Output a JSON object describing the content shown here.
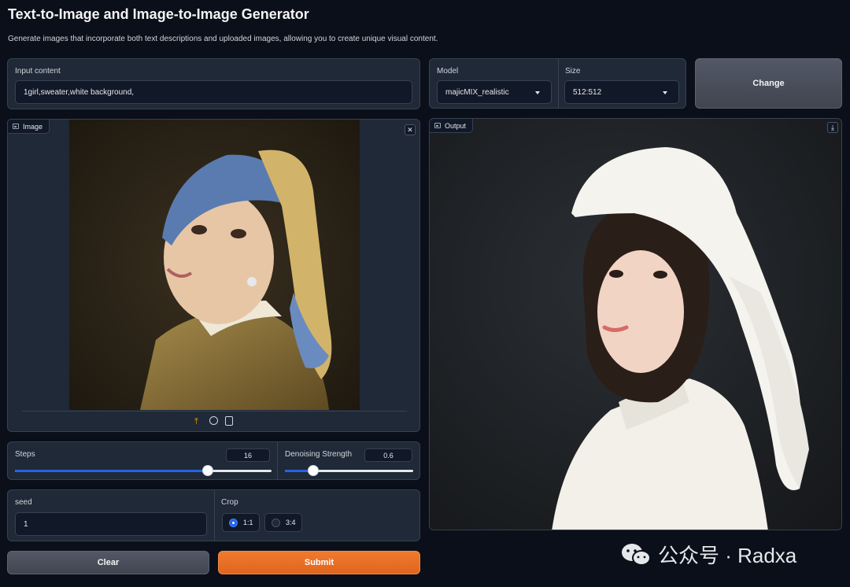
{
  "header": {
    "title": "Text-to-Image and Image-to-Image Generator",
    "subtitle": "Generate images that incorporate both text descriptions and uploaded images, allowing you to create unique visual content."
  },
  "input": {
    "label": "Input content",
    "value": "1girl,sweater,white background,"
  },
  "model": {
    "label": "Model",
    "value": "majicMIX_realistic"
  },
  "size": {
    "label": "Size",
    "value": "512:512"
  },
  "change_button": "Change",
  "image_panel": {
    "label": "Image",
    "close_icon": "close-icon",
    "tools": [
      "upload-icon",
      "webcam-icon",
      "clipboard-icon"
    ]
  },
  "output_panel": {
    "label": "Output",
    "download_icon": "download-icon"
  },
  "steps": {
    "label": "Steps",
    "value": "16",
    "fraction": 0.75
  },
  "denoise": {
    "label": "Denoising Strength",
    "value": "0.6",
    "fraction": 0.22
  },
  "seed": {
    "label": "seed",
    "value": "1"
  },
  "crop": {
    "label": "Crop",
    "options": [
      "1:1",
      "3:4"
    ],
    "selected": "1:1"
  },
  "buttons": {
    "clear": "Clear",
    "submit": "Submit"
  },
  "watermark": {
    "text": "公众号 · Radxa"
  },
  "colors": {
    "accent": "#2563eb",
    "submit": "#e8702a",
    "background": "#0b0f19"
  }
}
